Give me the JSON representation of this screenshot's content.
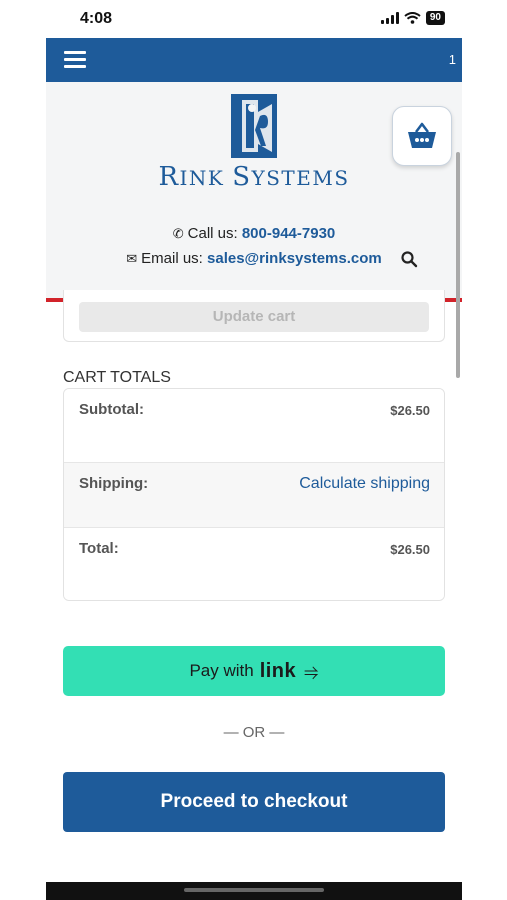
{
  "status_bar": {
    "time": "4:08",
    "battery": "90"
  },
  "nav": {
    "cart_count": "1"
  },
  "header": {
    "logo_text_first": "R",
    "logo_text_small1": "INK ",
    "logo_text_s": "S",
    "logo_text_small2": "YSTEMS",
    "call_label": "Call us:",
    "phone": "800-944-7930",
    "email_label": "Email us:",
    "email": "sales@rinksystems.com"
  },
  "cart": {
    "update_button": "Update cart",
    "totals_title": "CART TOTALS",
    "subtotal_label": "Subtotal:",
    "subtotal_value": "$26.50",
    "shipping_label": "Shipping:",
    "shipping_link": "Calculate shipping",
    "total_label": "Total:",
    "total_value": "$26.50",
    "pay_prefix": "Pay with",
    "pay_brand": "link",
    "pay_arrow": "⥤",
    "or_text": "— OR —",
    "checkout_button": "Proceed to checkout"
  },
  "colors": {
    "brand_blue": "#1e5b9a",
    "accent_red": "#d2232a",
    "link_green": "#33dfb4"
  },
  "icons": [
    "menu-icon",
    "basket-icon",
    "phone-icon",
    "envelope-icon",
    "search-icon"
  ]
}
